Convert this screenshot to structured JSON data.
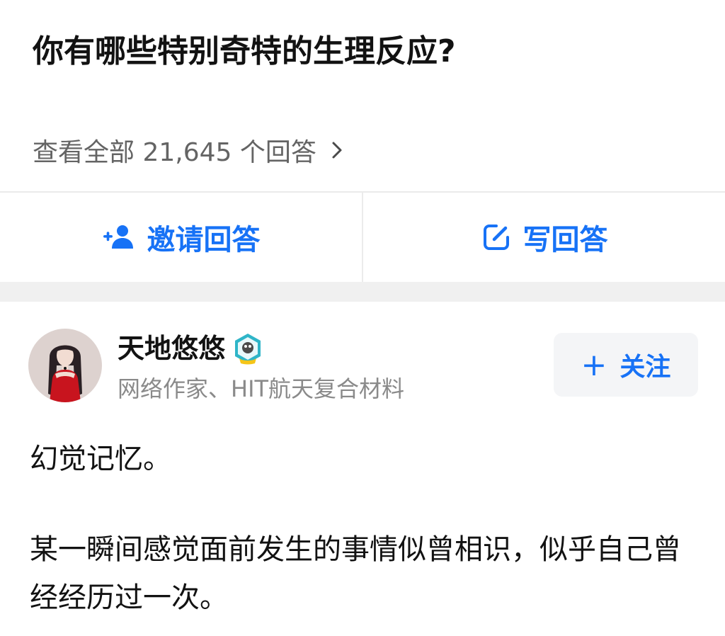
{
  "question": {
    "title": "你有哪些特别奇特的生理反应?",
    "view_all": "查看全部 21,645 个回答"
  },
  "actions": {
    "invite_label": "邀请回答",
    "write_label": "写回答"
  },
  "answer": {
    "author_name": "天地悠悠",
    "author_bio": "网络作家、HIT航天复合材料",
    "follow_label": "关注",
    "follow_plus": "+",
    "paragraphs": [
      "幻觉记忆。",
      "某一瞬间感觉面前发生的事情似曾相识，似乎自己曾经经历过一次。"
    ]
  },
  "colors": {
    "accent": "#1772f6",
    "title": "#121212",
    "secondary": "#646464",
    "bio": "#8a8a8a",
    "divider": "#ebebeb",
    "gap": "#f0f0f0"
  },
  "icons": {
    "invite": "add-user-icon",
    "write": "edit-icon",
    "chevron": "chevron-right-icon",
    "badge": "verified-badge-icon"
  }
}
